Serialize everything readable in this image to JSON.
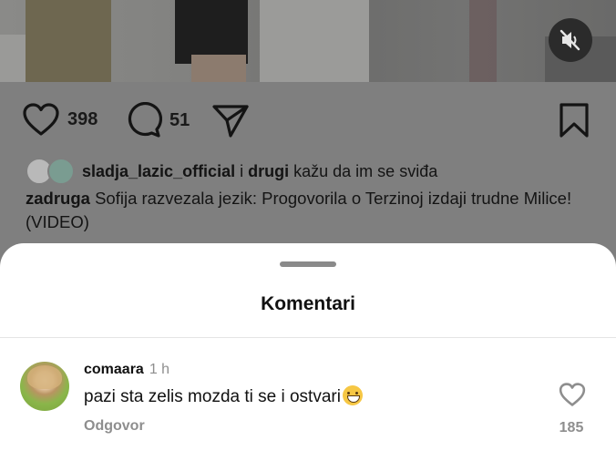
{
  "post": {
    "like_count": "398",
    "comment_count": "51",
    "liked_by_user": "sladja_lazic_official",
    "liked_by_connector": "i",
    "liked_by_others": "drugi",
    "liked_by_suffix": "kažu da im se sviđa",
    "caption_user": "zadruga",
    "caption_text": "Sofija razvezala jezik: Progovorila o Terzinoj izdaji trudne Milice! (VIDEO)"
  },
  "icons": {
    "mute": "speaker-muted-icon",
    "like": "heart-outline-icon",
    "comment": "speech-bubble-icon",
    "share": "paper-plane-icon",
    "save": "bookmark-icon"
  },
  "comments_sheet": {
    "title": "Komentari",
    "comments": [
      {
        "username": "comaara",
        "time": "1 h",
        "text": "pazi sta zelis mozda ti se i ostvari",
        "emoji": "grinning-face",
        "reply_label": "Odgovor",
        "likes": "185"
      }
    ]
  },
  "colors": {
    "overlay_gray": "#7f7f7f",
    "sheet_bg": "#ffffff",
    "muted_text": "#8e8e8e"
  }
}
